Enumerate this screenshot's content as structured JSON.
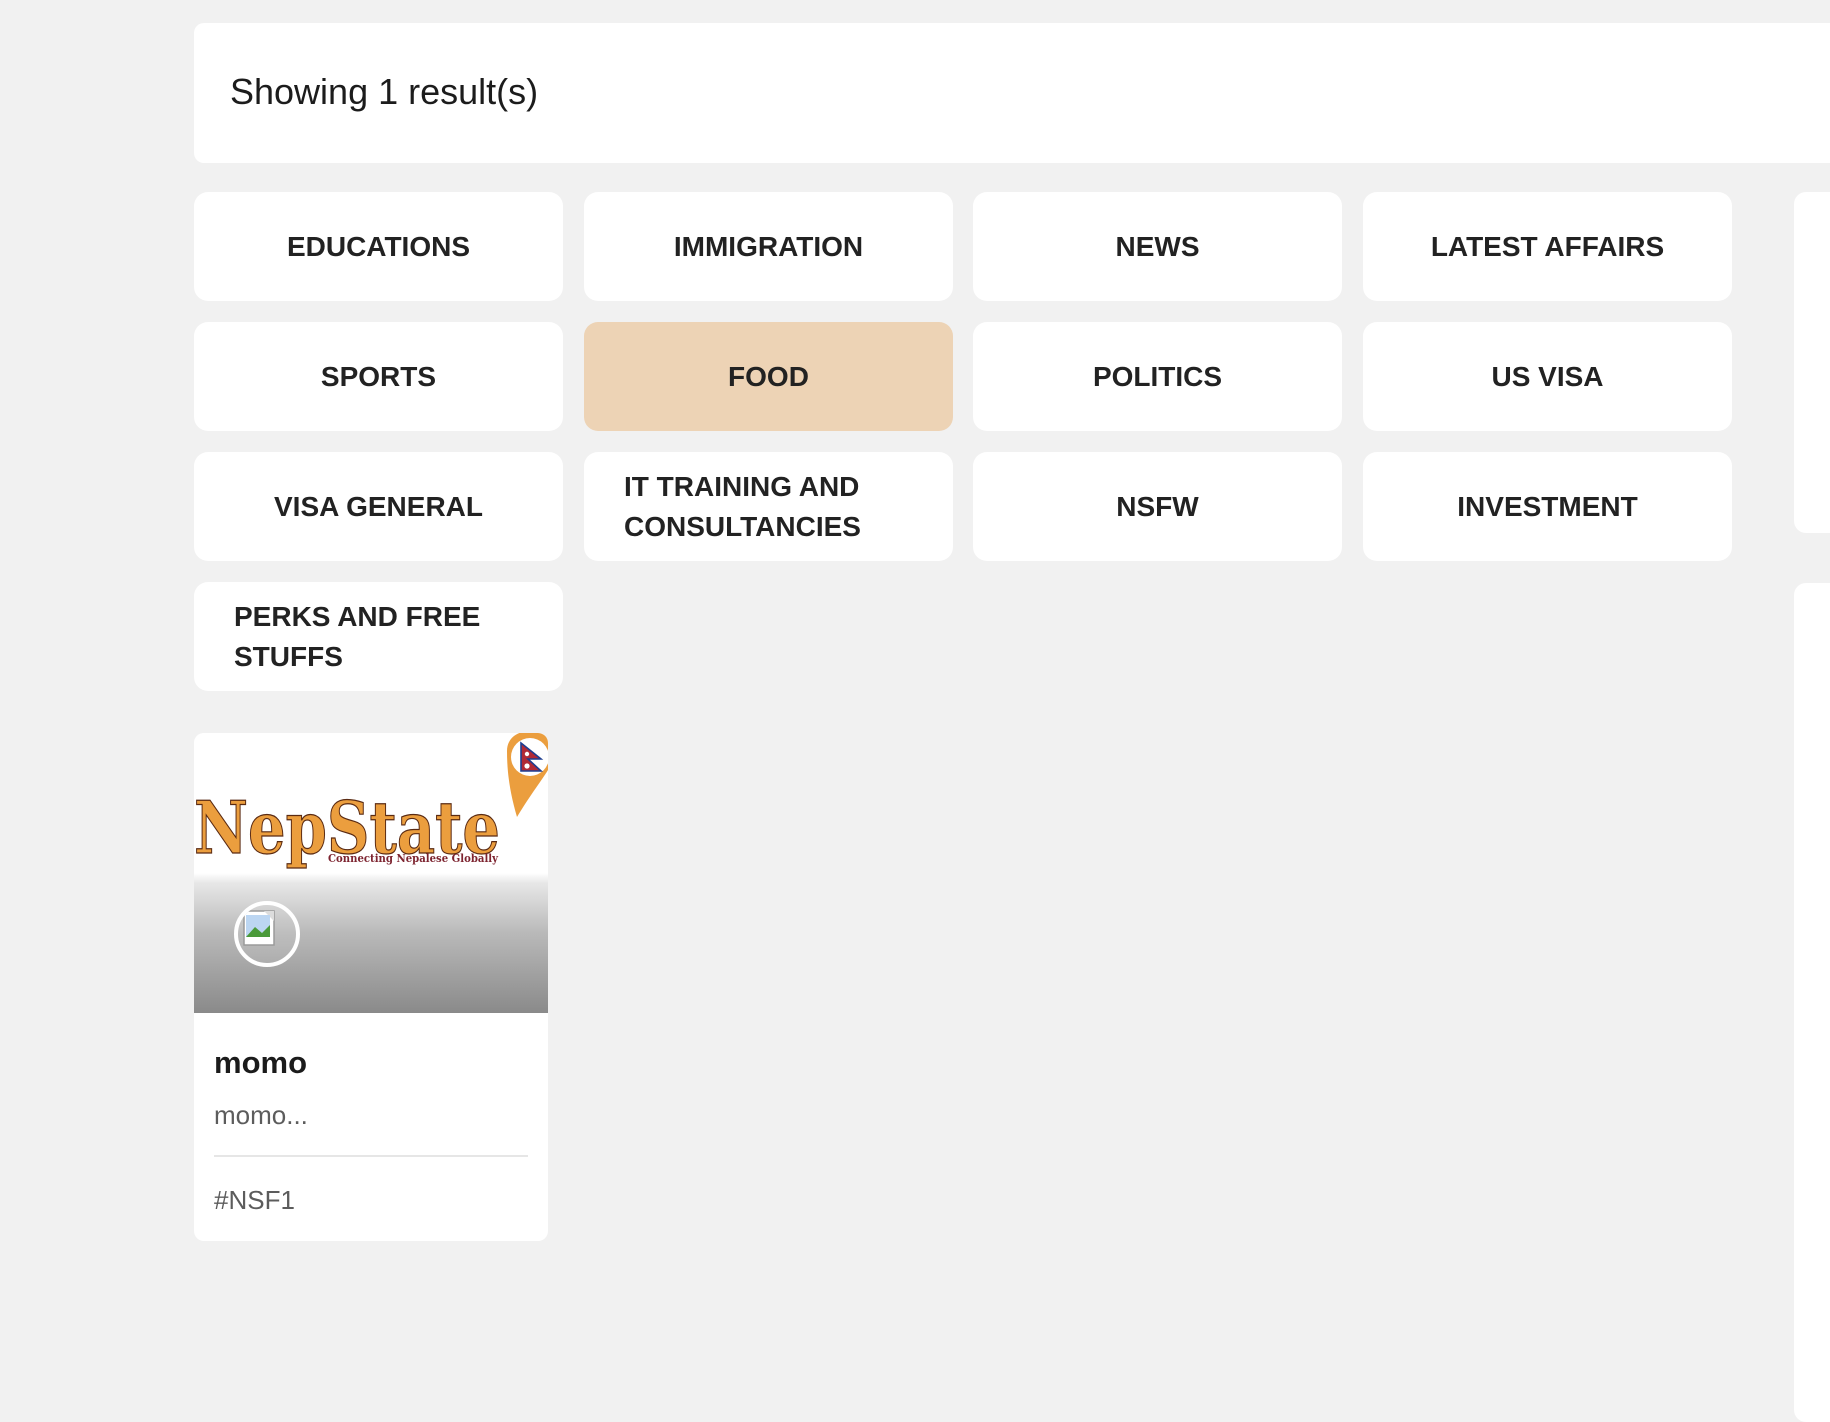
{
  "results": {
    "summary": "Showing 1 result(s)"
  },
  "categories": [
    {
      "label": "EDUCATIONS",
      "active": false
    },
    {
      "label": "IMMIGRATION",
      "active": false
    },
    {
      "label": "NEWS",
      "active": false
    },
    {
      "label": "LATEST AFFAIRS",
      "active": false
    },
    {
      "label": "SPORTS",
      "active": false
    },
    {
      "label": "FOOD",
      "active": true
    },
    {
      "label": "POLITICS",
      "active": false
    },
    {
      "label": "US VISA",
      "active": false
    },
    {
      "label": "VISA GENERAL",
      "active": false
    },
    {
      "label": "IT TRAINING AND CONSULTANCIES",
      "active": false
    },
    {
      "label": "NSFW",
      "active": false
    },
    {
      "label": "INVESTMENT",
      "active": false
    },
    {
      "label": "PERKS AND FREE STUFFS",
      "active": false
    }
  ],
  "card": {
    "logo_text": "NepState",
    "logo_tagline": "Connecting Nepalese Globally",
    "title": "momo",
    "excerpt": "momo...",
    "tag": "#NSF1"
  },
  "colors": {
    "active_category": "#edd3b5",
    "page_bg": "#f1f1f1",
    "logo_orange": "#eb9e3e",
    "logo_maroon": "#7d2430"
  },
  "icons": {
    "avatar": "broken-image-icon",
    "logo_pin": "map-pin-flag-icon"
  }
}
